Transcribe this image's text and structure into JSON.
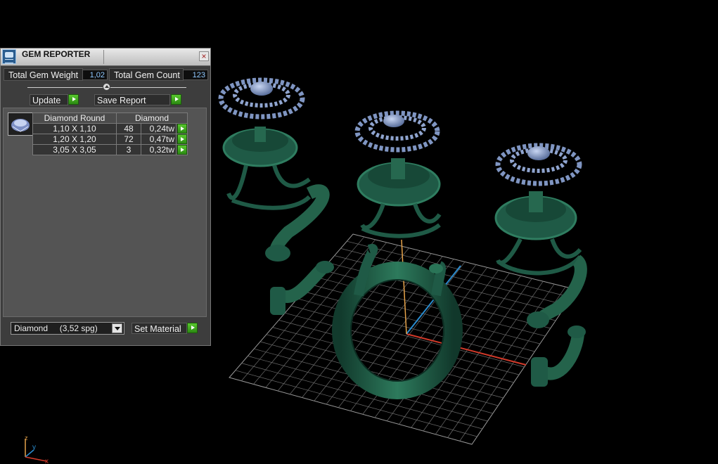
{
  "panel": {
    "title": "GEM REPORTER",
    "close_glyph": "×",
    "icon": "gem-reporter-app-icon",
    "total_weight_label": "Total Gem Weight",
    "total_weight_value": "1,02",
    "total_count_label": "Total Gem Count",
    "total_count_value": "123",
    "update_label": "Update",
    "save_report_label": "Save Report",
    "table": {
      "headers": [
        "Diamond Round",
        "Diamond"
      ],
      "rows": [
        {
          "size": "1,10 X 1,10",
          "count": "48",
          "weight": "0,24tw"
        },
        {
          "size": "1,20 X 1,20",
          "count": "72",
          "weight": "0,47tw"
        },
        {
          "size": "3,05 X 3,05",
          "count": "3",
          "weight": "0,32tw"
        }
      ]
    },
    "material_select_value": "Diamond     (3,52 spg)",
    "set_material_label": "Set Material"
  },
  "viewport": {
    "gizmo_labels": {
      "z": "z",
      "y": "y",
      "x": "x"
    },
    "colors": {
      "model": "#1f5a46",
      "gem": "#7f95c2",
      "axis_x": "#d23a2a",
      "axis_y": "#2a8ccf",
      "axis_z": "#e6a34a"
    }
  }
}
